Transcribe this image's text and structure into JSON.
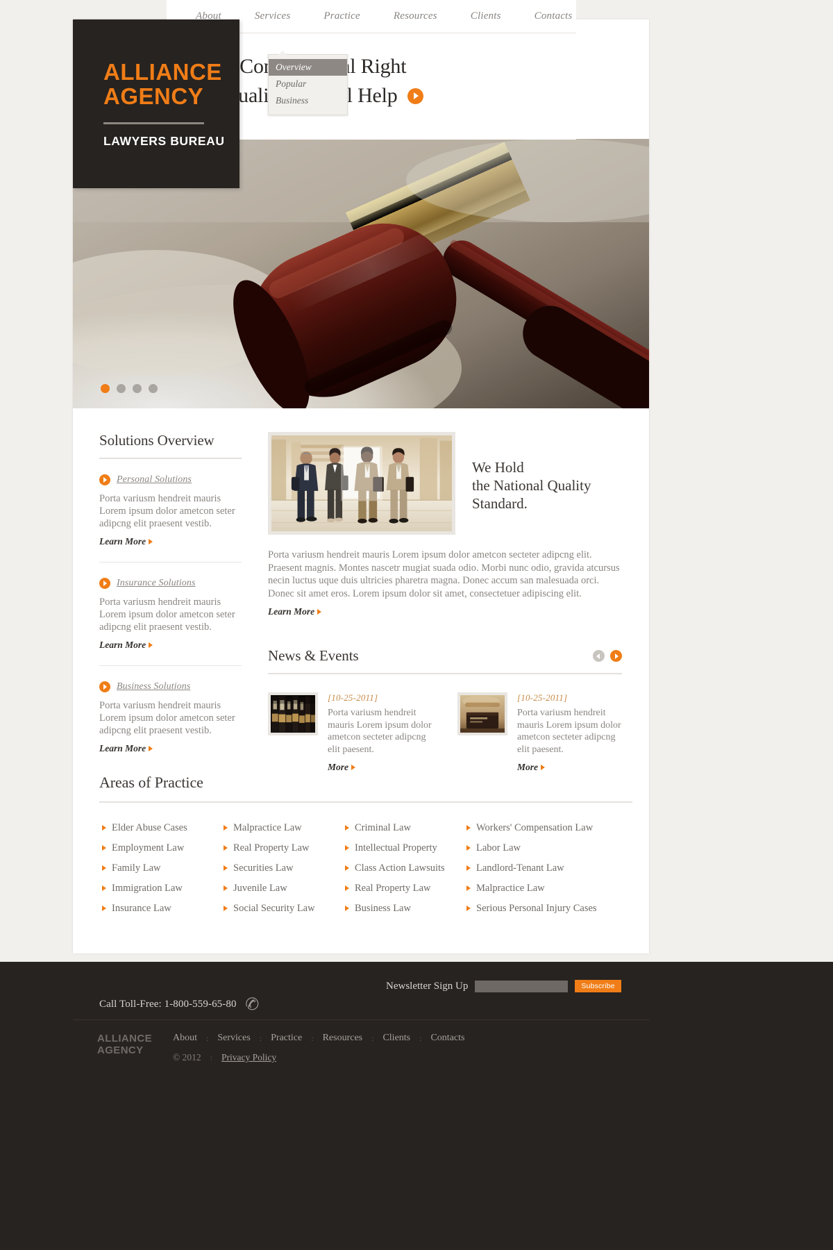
{
  "brand": {
    "name_line1": "ALLIANCE",
    "name_line2": "AGENCY",
    "tagline": "LAWYERS BUREAU",
    "accent_color": "#f07d17",
    "dark_color": "#272320"
  },
  "nav": {
    "items": [
      {
        "label": "About"
      },
      {
        "label": "Services"
      },
      {
        "label": "Practice"
      },
      {
        "label": "Resources"
      },
      {
        "label": "Clients"
      },
      {
        "label": "Contacts"
      }
    ],
    "dropdown": {
      "parent": "About",
      "items": [
        {
          "label": "Overview",
          "active": true
        },
        {
          "label": "Popular",
          "active": false
        },
        {
          "label": "Business",
          "active": false
        }
      ]
    }
  },
  "hero": {
    "headline_line1": "Your Constitutional Right",
    "headline_line2": "for Qualified Legal Help",
    "play_icon": "play-icon",
    "slides": [
      {
        "active": true
      },
      {
        "active": false
      },
      {
        "active": false
      },
      {
        "active": false
      }
    ]
  },
  "solutions": {
    "title": "Solutions Overview",
    "items": [
      {
        "link": "Personal Solutions",
        "text": "Porta variusm hendreit mauris Lorem ipsum dolor ametcon seter adipcng elit praesent vestib.",
        "cta": "Learn More"
      },
      {
        "link": "Insurance Solutions",
        "text": "Porta variusm hendreit mauris Lorem ipsum dolor ametcon seter adipcng elit praesent vestib.",
        "cta": "Learn More"
      },
      {
        "link": "Business Solutions",
        "text": "Porta variusm hendreit mauris Lorem ipsum dolor ametcon seter adipcng elit praesent vestib.",
        "cta": "Learn More"
      }
    ]
  },
  "quality": {
    "heading_line1": "We Hold",
    "heading_line2": "the National Quality",
    "heading_line3": "Standard.",
    "body": "Porta variusm hendreit mauris Lorem ipsum dolor ametcon secteter adipcng elit. Praesent magnis. Montes nascetr mugiat suada odio. Morbi nunc odio, gravida atcursus necin luctus uque duis ultricies pharetra magna. Donec accum san malesuada orci. Donec sit amet eros. Lorem ipsum dolor sit amet, consectetuer adipiscing elit.",
    "cta": "Learn More"
  },
  "news": {
    "title": "News & Events",
    "prev_icon": "chevron-left-icon",
    "next_icon": "chevron-right-icon",
    "items": [
      {
        "date": "[10-25-2011]",
        "text": "Porta variusm hendreit mauris Lorem ipsum dolor ametcon secteter adipcng elit paesent.",
        "cta": "More"
      },
      {
        "date": "[10-25-2011]",
        "text": "Porta variusm hendreit mauris Lorem ipsum dolor ametcon secteter adipcng elit paesent.",
        "cta": "More"
      }
    ]
  },
  "practice": {
    "title": "Areas of Practice",
    "columns": [
      [
        "Elder Abuse Cases",
        "Employment Law",
        "Family Law",
        "Immigration Law",
        "Insurance Law"
      ],
      [
        "Malpractice Law",
        "Real Property Law",
        "Securities Law",
        "Juvenile Law",
        "Social Security Law"
      ],
      [
        "Criminal Law",
        "Intellectual Property",
        "Class Action Lawsuits",
        "Real Property Law",
        "Business Law"
      ],
      [
        "Workers' Compensation Law",
        "Labor Law",
        "Landlord-Tenant Law",
        "Malpractice Law",
        "Serious Personal Injury Cases"
      ]
    ]
  },
  "footer": {
    "toll_free": "Call Toll-Free: 1-800-559-65-80",
    "phone_icon": "phone-icon",
    "newsletter_label": "Newsletter Sign Up",
    "newsletter_value": "",
    "newsletter_placeholder": "",
    "subscribe_label": "Subscribe",
    "logo_line1": "ALLIANCE",
    "logo_line2": "AGENCY",
    "links": [
      "About",
      "Services",
      "Practice",
      "Resources",
      "Clients",
      "Contacts"
    ],
    "separator": ":",
    "copyright": "© 2012",
    "privacy": "Privacy Policy"
  }
}
